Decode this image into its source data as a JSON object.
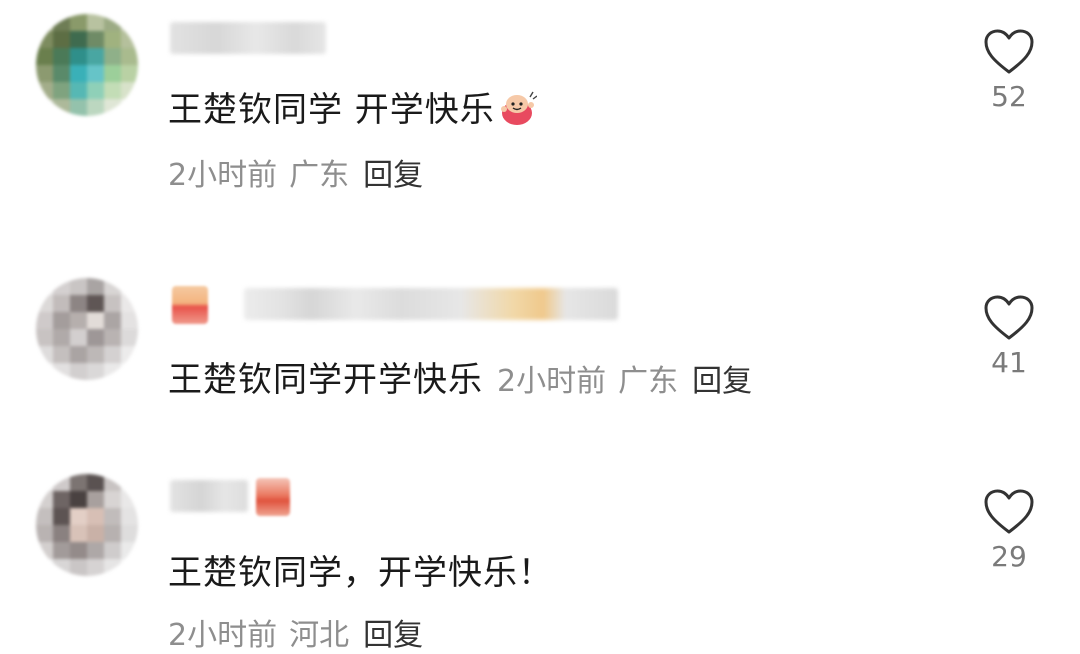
{
  "comments": [
    {
      "text": "王楚钦同学  开学快乐",
      "emoji": "cheering-sticker-emoji",
      "time": "2小时前",
      "location": "广东",
      "reply_label": "回复",
      "like_count": "52",
      "like_icon": "heart-outline-icon"
    },
    {
      "text": "王楚钦同学开学快乐",
      "time": "2小时前",
      "location": "广东",
      "reply_label": "回复",
      "like_count": "41",
      "like_icon": "heart-outline-icon"
    },
    {
      "text": "王楚钦同学，开学快乐！",
      "time": "2小时前",
      "location": "河北",
      "reply_label": "回复",
      "like_count": "29",
      "like_icon": "heart-outline-icon"
    }
  ],
  "colors": {
    "text": "#1a1a1a",
    "meta": "#8e8e8e",
    "reply": "#333333",
    "heart_stroke": "#333333"
  }
}
